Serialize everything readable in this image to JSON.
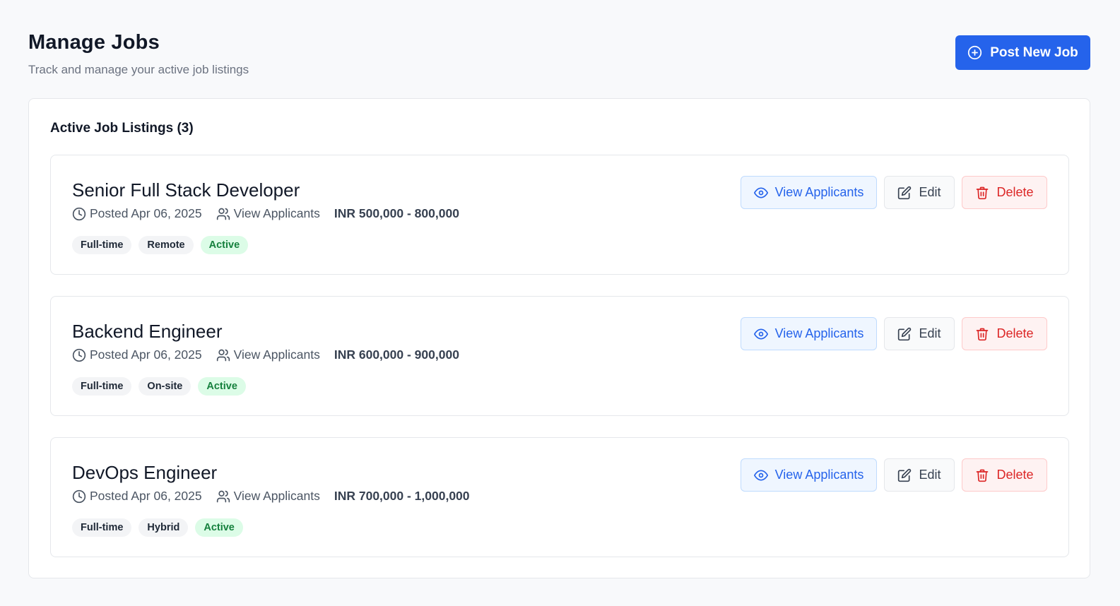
{
  "header": {
    "title": "Manage Jobs",
    "subtitle": "Track and manage your active job listings",
    "post_button_label": "Post New Job"
  },
  "listings": {
    "title": "Active Job Listings (3)",
    "jobs": [
      {
        "title": "Senior Full Stack Developer",
        "posted": "Posted Apr 06, 2025",
        "applicants_link": "View Applicants",
        "salary": "INR 500,000 - 800,000",
        "tags": [
          "Full-time",
          "Remote",
          "Active"
        ]
      },
      {
        "title": "Backend Engineer",
        "posted": "Posted Apr 06, 2025",
        "applicants_link": "View Applicants",
        "salary": "INR 600,000 - 900,000",
        "tags": [
          "Full-time",
          "On-site",
          "Active"
        ]
      },
      {
        "title": "DevOps Engineer",
        "posted": "Posted Apr 06, 2025",
        "applicants_link": "View Applicants",
        "salary": "INR 700,000 - 1,000,000",
        "tags": [
          "Full-time",
          "Hybrid",
          "Active"
        ]
      }
    ]
  },
  "actions": {
    "view_label": "View Applicants",
    "edit_label": "Edit",
    "delete_label": "Delete"
  },
  "icons": {
    "post": "plus-circle-icon",
    "posted": "clock-icon",
    "applicants": "users-icon",
    "view": "eye-icon",
    "edit": "edit-icon",
    "delete": "trash-icon"
  },
  "colors": {
    "primary": "#2563eb",
    "active_tag_bg": "#dcfce7",
    "active_tag_text": "#15803d",
    "delete": "#dc2626"
  }
}
